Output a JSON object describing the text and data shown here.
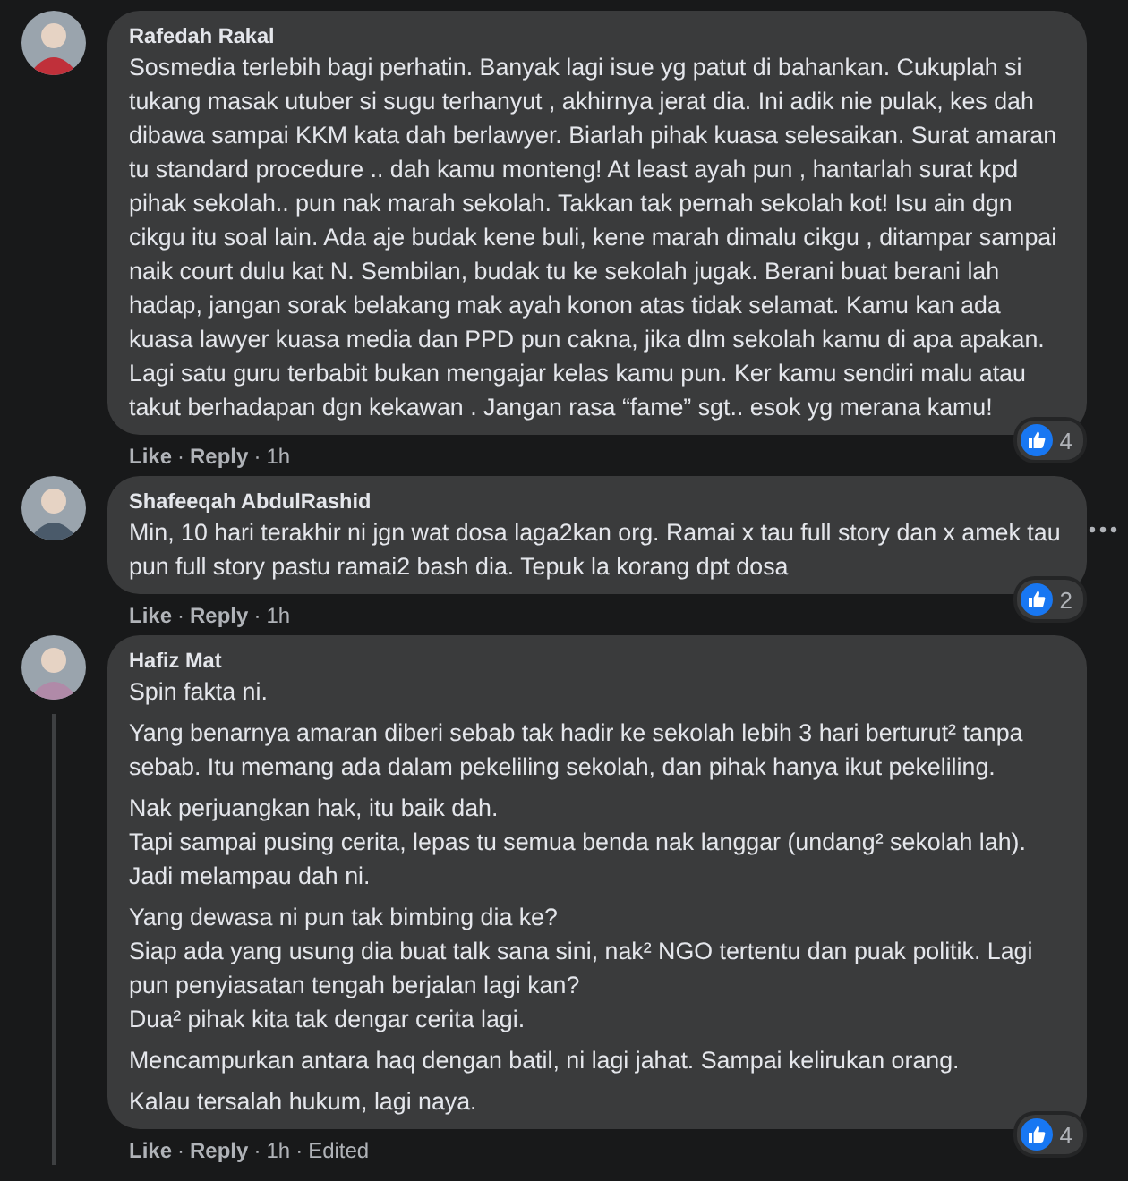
{
  "comments": [
    {
      "author": "Rafedah Rakal",
      "paragraphs": [
        "Sosmedia terlebih bagi perhatin. Banyak lagi isue yg patut di bahankan. Cukuplah si tukang masak utuber si sugu terhanyut , akhirnya jerat dia. Ini adik nie pulak, kes dah dibawa sampai KKM kata dah berlawyer. Biarlah pihak kuasa selesaikan. Surat amaran tu standard procedure .. dah kamu monteng! At least ayah pun , hantarlah surat kpd pihak sekolah.. pun nak marah sekolah. Takkan tak pernah sekolah kot! Isu ain dgn cikgu itu soal lain. Ada aje budak kene buli, kene marah dimalu cikgu , ditampar sampai naik court dulu kat N. Sembilan, budak tu ke sekolah jugak. Berani buat berani lah hadap, jangan sorak belakang mak ayah konon atas tidak selamat. Kamu kan ada kuasa lawyer kuasa media dan PPD pun cakna, jika dlm sekolah kamu di apa apakan. Lagi satu guru terbabit bukan mengajar kelas kamu pun. Ker kamu sendiri malu atau takut berhadapan dgn kekawan . Jangan rasa “fame” sgt.. esok yg merana kamu!"
      ],
      "reactions": "4",
      "menu_visible": false,
      "thread_line": false,
      "meta": [
        {
          "kind": "link",
          "text": "Like"
        },
        {
          "kind": "dot",
          "text": "·"
        },
        {
          "kind": "link",
          "text": "Reply"
        },
        {
          "kind": "dot",
          "text": "·"
        },
        {
          "kind": "plain",
          "text": "1h"
        }
      ]
    },
    {
      "author": "Shafeeqah AbdulRashid",
      "paragraphs": [
        "Min, 10 hari terakhir ni jgn wat dosa laga2kan org. Ramai x tau full story dan x amek tau pun full story pastu ramai2 bash dia. Tepuk la korang dpt dosa"
      ],
      "reactions": "2",
      "menu_visible": true,
      "thread_line": false,
      "meta": [
        {
          "kind": "link",
          "text": "Like"
        },
        {
          "kind": "dot",
          "text": "·"
        },
        {
          "kind": "link",
          "text": "Reply"
        },
        {
          "kind": "dot",
          "text": "·"
        },
        {
          "kind": "plain",
          "text": "1h"
        }
      ]
    },
    {
      "author": "Hafiz Mat",
      "paragraphs": [
        "Spin fakta ni.",
        "Yang benarnya amaran diberi sebab tak hadir ke sekolah lebih 3 hari berturut² tanpa sebab. Itu memang ada dalam pekeliling sekolah, dan pihak hanya ikut pekeliling.",
        "Nak perjuangkan hak, itu baik dah.\nTapi sampai pusing cerita, lepas tu semua benda nak langgar (undang² sekolah lah).\nJadi melampau dah ni.",
        "Yang dewasa ni pun tak bimbing dia ke?\nSiap ada yang usung dia buat talk sana sini, nak² NGO tertentu dan puak politik. Lagi pun penyiasatan tengah berjalan lagi kan?\nDua² pihak kita tak dengar cerita lagi.",
        "Mencampurkan antara haq dengan batil, ni lagi jahat. Sampai kelirukan orang.",
        "Kalau tersalah hukum, lagi naya."
      ],
      "reactions": "4",
      "menu_visible": false,
      "thread_line": true,
      "meta": [
        {
          "kind": "link",
          "text": "Like"
        },
        {
          "kind": "dot",
          "text": "·"
        },
        {
          "kind": "link",
          "text": "Reply"
        },
        {
          "kind": "dot",
          "text": "·"
        },
        {
          "kind": "plain",
          "text": "1h"
        },
        {
          "kind": "dot",
          "text": "·"
        },
        {
          "kind": "plain",
          "text": "Edited"
        }
      ]
    }
  ]
}
